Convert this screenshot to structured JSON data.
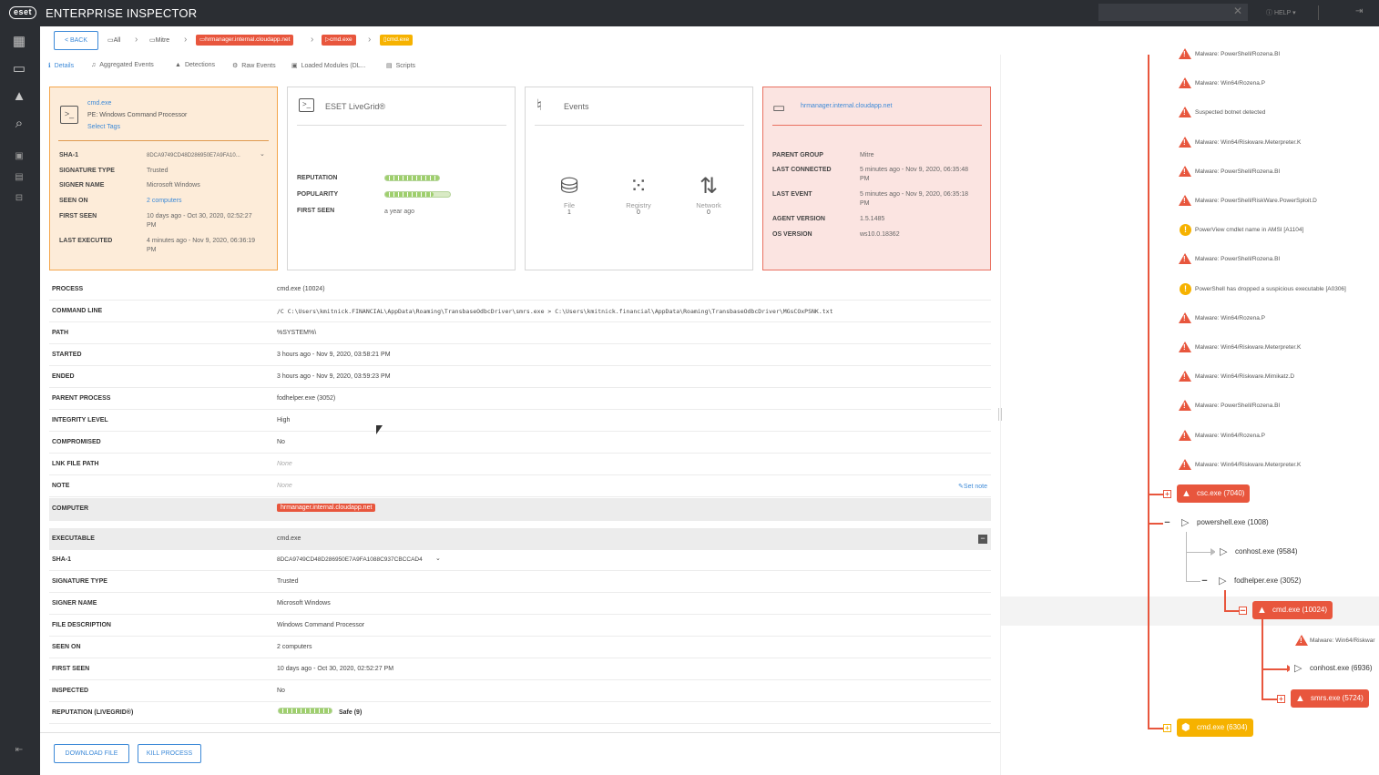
{
  "app": {
    "logo": "eset",
    "title": "ENTERPRISE INSPECTOR",
    "help": "HELP",
    "logout": "LO..."
  },
  "breadcrumb": {
    "back": "< BACK",
    "all": "All",
    "mitre": "Mitre",
    "computer": "hrmanager.internal.cloudapp.net",
    "process1": "cmd.exe",
    "process2": "cmd.exe"
  },
  "tabs": [
    "Details",
    "Aggregated Events",
    "Detections",
    "Raw Events",
    "Loaded Modules (DL...",
    "Scripts"
  ],
  "file_panel": {
    "name": "cmd.exe",
    "desc": "PE: Windows Command Processor",
    "tags": "Select Tags",
    "rows": [
      {
        "label": "SHA-1",
        "value": "8DCA9749CD48D286950E7A9FA10..."
      },
      {
        "label": "SIGNATURE TYPE",
        "value": "Trusted"
      },
      {
        "label": "SIGNER NAME",
        "value": "Microsoft Windows"
      },
      {
        "label": "SEEN ON",
        "value": "2 computers"
      },
      {
        "label": "FIRST SEEN",
        "value": "10 days ago - Oct 30, 2020, 02:52:27",
        "value2": "PM"
      },
      {
        "label": "LAST EXECUTED",
        "value": "4 minutes ago - Nov 9, 2020, 06:36:19",
        "value2": "PM"
      }
    ]
  },
  "livegrid_panel": {
    "title": "ESET LiveGrid®",
    "reputation_label": "REPUTATION",
    "reputation_level": 1.0,
    "popularity_label": "POPULARITY",
    "popularity_level": 0.75,
    "first_seen_label": "FIRST SEEN",
    "first_seen_value": "a year ago"
  },
  "events_panel": {
    "title": "Events",
    "items": [
      {
        "name": "File",
        "count": "1",
        "icon": "drive-icon"
      },
      {
        "name": "Registry",
        "count": "0",
        "icon": "registry-icon"
      },
      {
        "name": "Network",
        "count": "0",
        "icon": "network-icon"
      }
    ]
  },
  "computer_panel": {
    "name": "hrmanager.internal.cloudapp.net",
    "rows": [
      {
        "label": "PARENT GROUP",
        "value": "Mitre",
        "value2": ""
      },
      {
        "label": "LAST CONNECTED",
        "value": "5 minutes ago - Nov 9, 2020, 06:35:48",
        "value2": "PM"
      },
      {
        "label": "LAST EVENT",
        "value": "5 minutes ago - Nov 9, 2020, 06:35:18",
        "value2": "PM"
      },
      {
        "label": "AGENT VERSION",
        "value": "1.5.1485",
        "value2": ""
      },
      {
        "label": "OS VERSION",
        "value": "ws10.0.18362",
        "value2": ""
      }
    ]
  },
  "details": {
    "process": {
      "label": "PROCESS",
      "value": "cmd.exe (10024)"
    },
    "command_line": {
      "label": "COMMAND LINE",
      "value": "/C C:\\Users\\kmitnick.FINANCIAL\\AppData\\Roaming\\TransbaseOdbcDriver\\smrs.exe > C:\\Users\\kmitnick.financial\\AppData\\Roaming\\TransbaseOdbcDriver\\MGsCOxPSNK.txt"
    },
    "path": {
      "label": "PATH",
      "value": "%SYSTEM%\\"
    },
    "started": {
      "label": "STARTED",
      "value": "3 hours ago - Nov 9, 2020, 03:58:21 PM"
    },
    "ended": {
      "label": "ENDED",
      "value": "3 hours ago - Nov 9, 2020, 03:59:23 PM"
    },
    "parent_process": {
      "label": "PARENT PROCESS",
      "value": "fodhelper.exe (3052)"
    },
    "integrity_level": {
      "label": "INTEGRITY LEVEL",
      "value": "High"
    },
    "compromised": {
      "label": "COMPROMISED",
      "value": "No"
    },
    "lnk_path": {
      "label": "LNK FILE PATH",
      "value": "None"
    },
    "note": {
      "label": "NOTE",
      "value": "None",
      "action": "Set note"
    },
    "computer": {
      "label": "COMPUTER",
      "value": "hrmanager.internal.cloudapp.net"
    },
    "executable": {
      "label": "EXECUTABLE",
      "value": "cmd.exe",
      "collapse": "−"
    },
    "sha1": {
      "label": "SHA-1",
      "value": "8DCA9749CD48D286950E7A9FA1088C937CBCCAD4"
    },
    "signature_type": {
      "label": "SIGNATURE TYPE",
      "value": "Trusted"
    },
    "signer_name": {
      "label": "SIGNER NAME",
      "value": "Microsoft Windows"
    },
    "file_description": {
      "label": "FILE DESCRIPTION",
      "value": "Windows Command Processor"
    },
    "seen_on": {
      "label": "SEEN ON",
      "value": "2 computers"
    },
    "first_seen": {
      "label": "FIRST SEEN",
      "value": "10 days ago - Oct 30, 2020, 02:52:27 PM"
    },
    "inspected": {
      "label": "INSPECTED",
      "value": "No"
    },
    "reputation": {
      "label": "REPUTATION (LIVEGRID®)",
      "value": "Safe (9)",
      "level": 1.0
    }
  },
  "footer": {
    "download": "DOWNLOAD FILE",
    "kill": "KILL PROCESS"
  },
  "tree": {
    "alerts": [
      {
        "text": "Malware: PowerShell/Rozena.BI",
        "kind": "danger"
      },
      {
        "text": "Malware: Win64/Rozena.P",
        "kind": "danger"
      },
      {
        "text": "Suspected botnet detected",
        "kind": "danger"
      },
      {
        "text": "Malware: Win64/Riskware.Meterpreter.K",
        "kind": "danger"
      },
      {
        "text": "Malware: PowerShell/Rozena.BI",
        "kind": "danger"
      },
      {
        "text": "Malware: PowerShell/RiskWare.PowerSploit.D",
        "kind": "danger"
      },
      {
        "text": "PowerView cmdlet name in AMSI [A1104]",
        "kind": "warning"
      },
      {
        "text": "Malware: PowerShell/Rozena.BI",
        "kind": "danger"
      },
      {
        "text": "PowerShell has dropped a suspicious executable [A0306]",
        "kind": "warning"
      },
      {
        "text": "Malware: Win64/Rozena.P",
        "kind": "danger"
      },
      {
        "text": "Malware: Win64/Riskware.Meterpreter.K",
        "kind": "danger"
      },
      {
        "text": "Malware: Win64/Riskware.Mimikatz.D",
        "kind": "danger"
      },
      {
        "text": "Malware: PowerShell/Rozena.BI",
        "kind": "danger"
      },
      {
        "text": "Malware: Win64/Rozena.P",
        "kind": "danger"
      },
      {
        "text": "Malware: Win64/Riskware.Meterpreter.K",
        "kind": "danger"
      }
    ],
    "nodes": {
      "csc": "csc.exe (7040)",
      "powershell": "powershell.exe (1008)",
      "conhost1": "conhost.exe (9584)",
      "fodhelper": "fodhelper.exe (3052)",
      "cmd": "cmd.exe (10024)",
      "cmd_alert": "Malware: Win64/Riskwar",
      "conhost2": "conhost.exe (6936)",
      "smrs": "smrs.exe (5724)",
      "cmd2": "cmd.exe (6304)"
    }
  },
  "colors": {
    "accent": "#3d8ad8",
    "danger": "#e8563d",
    "warning": "#f6b200",
    "chrome": "#2b2e33"
  }
}
